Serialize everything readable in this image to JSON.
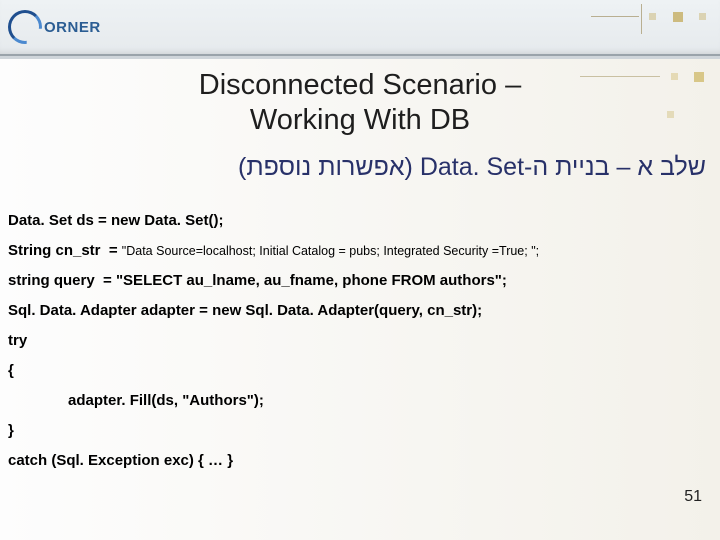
{
  "logo": {
    "text": "ORNER"
  },
  "title": {
    "line1": "Disconnected Scenario –",
    "line2": "Working With DB"
  },
  "subtitle": "שלב א – בניית ה-Data. Set (אפשרות נוספת)",
  "code": {
    "l1": "Data. Set ds = new Data. Set();",
    "l2a": "String cn_str  = ",
    "l2b": "\"Data Source=localhost; Initial Catalog = pubs; Integrated Security =True; \";",
    "l3": "string query  = \"SELECT au_lname, au_fname, phone FROM authors\";",
    "l4": "Sql. Data. Adapter adapter = new Sql. Data. Adapter(query, cn_str);",
    "l5": "try",
    "l6": "{",
    "l7": "adapter. Fill(ds, \"Authors\");",
    "l8": "}",
    "l9": "catch (Sql. Exception exc) { … }"
  },
  "page_number": "51"
}
